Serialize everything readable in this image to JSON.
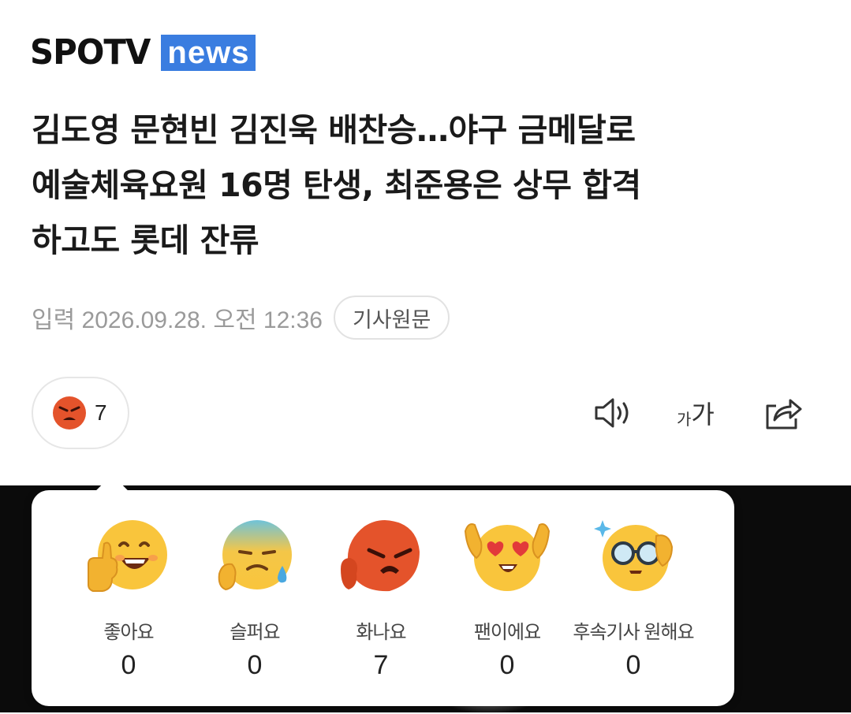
{
  "brand": {
    "logo_main": "SPOTV",
    "logo_sub": "news",
    "accent_color": "#3a7de0"
  },
  "article": {
    "headline_lines": [
      "김도영 문현빈 김진욱 배찬승…야구 금메달로",
      "예술체육요원 16명 탄생, 최준용은 상무 합격",
      "하고도 롯데 잔류"
    ],
    "date": "입력 2026.09.28. 오전 12:36",
    "original_button": "기사원문"
  },
  "reaction_summary": {
    "icon": "angry-face-icon",
    "count": "7"
  },
  "toolbar": {
    "audio_icon": "speaker-icon",
    "font_size_label_small": "가",
    "font_size_label_large": "가",
    "share_icon": "share-icon"
  },
  "reactions": [
    {
      "id": "like",
      "label": "좋아요",
      "count": "0",
      "icon": "thumbs-up-face-icon"
    },
    {
      "id": "sad",
      "label": "슬퍼요",
      "count": "0",
      "icon": "crying-face-icon"
    },
    {
      "id": "angry",
      "label": "화나요",
      "count": "7",
      "icon": "angry-face-icon"
    },
    {
      "id": "fan",
      "label": "팬이에요",
      "count": "0",
      "icon": "heart-eyes-face-icon"
    },
    {
      "id": "follow",
      "label": "후속기사 원해요",
      "count": "0",
      "icon": "glasses-face-icon"
    }
  ]
}
